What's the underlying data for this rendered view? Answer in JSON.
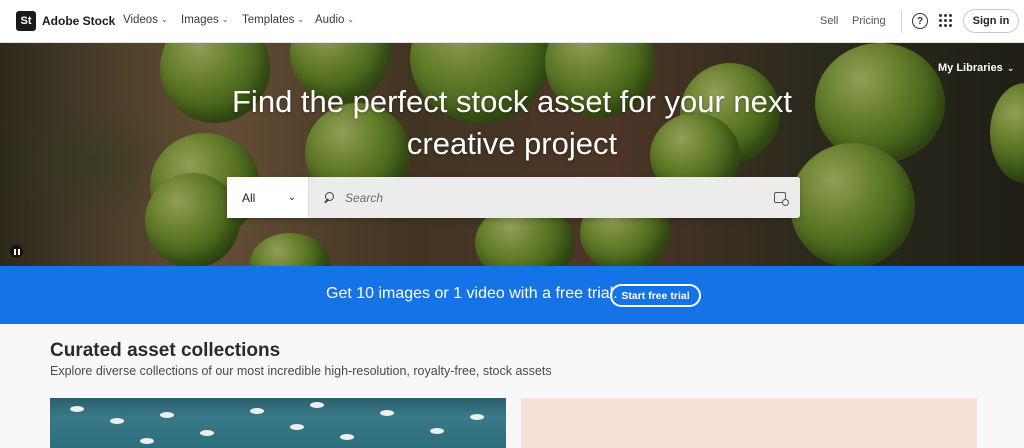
{
  "header": {
    "logo_mark": "St",
    "logo_text": "Adobe Stock",
    "nav": [
      {
        "label": "Videos"
      },
      {
        "label": "Images"
      },
      {
        "label": "Templates"
      },
      {
        "label": "Audio"
      }
    ],
    "sell_label": "Sell",
    "pricing_label": "Pricing",
    "help_glyph": "?",
    "signin_label": "Sign in",
    "icons": [
      "help-icon",
      "apps-grid-icon",
      "chevron-down-icon"
    ]
  },
  "hero": {
    "title_line1": "Find the perfect stock asset for your next",
    "title_line2": "creative project",
    "my_libraries_label": "My Libraries",
    "search": {
      "filter_value": "All",
      "placeholder": "Search"
    }
  },
  "banner": {
    "text": "Get 10 images or 1 video with a free trial.",
    "button_label": "Start free trial",
    "color": "#1473e6"
  },
  "collections": {
    "title": "Curated asset collections",
    "subtitle": "Explore diverse collections of our most incredible high-resolution, royalty-free, stock assets"
  }
}
